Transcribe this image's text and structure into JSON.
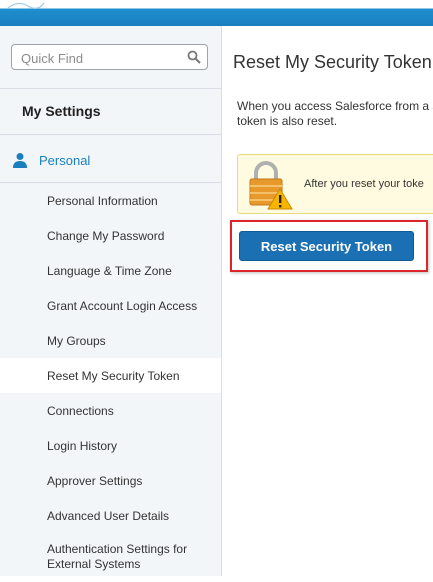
{
  "header": {
    "accent": "#1a7fbe"
  },
  "sidebar": {
    "search": {
      "placeholder": "Quick Find",
      "value": ""
    },
    "section_title": "My Settings",
    "group": {
      "label": "Personal",
      "icon": "person-icon"
    },
    "items": [
      {
        "label": "Personal Information"
      },
      {
        "label": "Change My Password"
      },
      {
        "label": "Language & Time Zone"
      },
      {
        "label": "Grant Account Login Access"
      },
      {
        "label": "My Groups"
      },
      {
        "label": "Reset My Security Token",
        "active": true
      },
      {
        "label": "Connections"
      },
      {
        "label": "Login History"
      },
      {
        "label": "Approver Settings"
      },
      {
        "label": "Advanced User Details"
      },
      {
        "label": "Authentication Settings for External Systems"
      }
    ]
  },
  "main": {
    "title": "Reset My Security Token",
    "intro": "When you access Salesforce from a security token is also reset.",
    "warning": {
      "icon": "lock-warning-icon",
      "text": "After you reset your toke"
    },
    "button_label": "Reset Security Token"
  },
  "colors": {
    "button": "#1b6fb3",
    "highlight_border": "#d9262b",
    "warning_bg": "#fffbe0"
  }
}
